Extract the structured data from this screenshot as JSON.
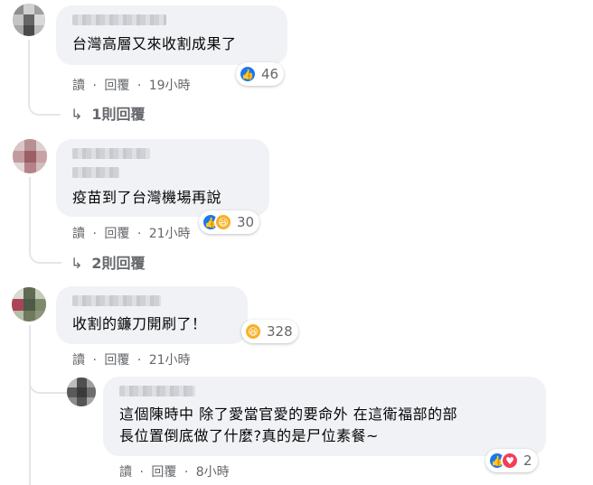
{
  "comments": [
    {
      "text": "台灣高層又來收割成果了",
      "actions": [
        "讀",
        "回覆",
        "19小時"
      ],
      "reactions": {
        "types": [
          "like"
        ],
        "count": "46"
      },
      "replies_link": "1則回覆"
    },
    {
      "text": "疫苗到了台灣機場再說",
      "actions": [
        "讀",
        "回覆",
        "21小時"
      ],
      "reactions": {
        "types": [
          "like",
          "haha"
        ],
        "count": "30"
      },
      "replies_link": "2則回覆"
    },
    {
      "text": "收割的鐮刀開刷了！",
      "actions": [
        "讀",
        "回覆",
        "21小時"
      ],
      "reactions": {
        "types": [
          "haha"
        ],
        "count": "328"
      }
    }
  ],
  "reply": {
    "lines": [
      "這個陳時中 除了愛當官愛的要命外 在這衛福部的部",
      "長位置倒底做了什麼?真的是尸位素餐~"
    ],
    "actions": [
      "讀",
      "回覆",
      "8小時"
    ],
    "reactions": {
      "types": [
        "like",
        "love"
      ],
      "count": "2"
    }
  },
  "separator": "·",
  "colors": {
    "like": "#1877f2",
    "haha": "#f7b125",
    "love": "#f33e58",
    "bubble": "#f0f2f5",
    "meta": "#65676b"
  }
}
